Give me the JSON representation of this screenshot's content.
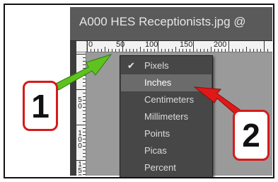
{
  "window": {
    "title": "A000 HES Receptionists.jpg @"
  },
  "ruler": {
    "horizontal_labels": [
      "0",
      "50",
      "100",
      "150",
      "200"
    ],
    "vertical_labels": [
      "5\n0",
      "1\n0\n0",
      "1\n5\n0"
    ]
  },
  "context_menu": {
    "items": [
      {
        "label": "Pixels",
        "checked": true,
        "highlighted": false
      },
      {
        "label": "Inches",
        "checked": false,
        "highlighted": true
      },
      {
        "label": "Centimeters",
        "checked": false,
        "highlighted": false
      },
      {
        "label": "Millimeters",
        "checked": false,
        "highlighted": false
      },
      {
        "label": "Points",
        "checked": false,
        "highlighted": false
      },
      {
        "label": "Picas",
        "checked": false,
        "highlighted": false
      },
      {
        "label": "Percent",
        "checked": false,
        "highlighted": false
      }
    ],
    "checkmark": "✔"
  },
  "callouts": {
    "step1": "1",
    "step2": "2"
  },
  "colors": {
    "badge_border": "#d61a1a",
    "arrow1": "#5fc21e",
    "arrow2": "#e01818"
  }
}
